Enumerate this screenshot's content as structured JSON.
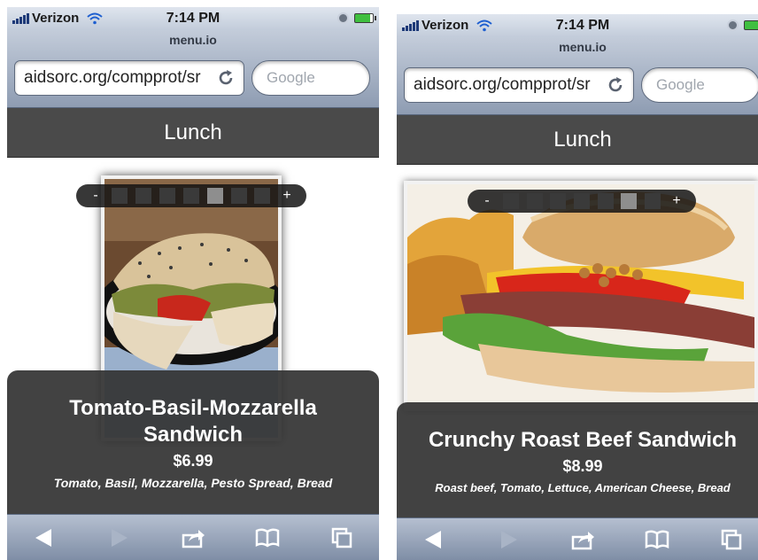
{
  "status": {
    "carrier": "Verizon",
    "time": "7:14 PM",
    "icons": [
      "signal-icon",
      "wifi-icon",
      "lock-icon",
      "battery-icon"
    ]
  },
  "browser": {
    "host": "menu.io",
    "url": "aidsorc.org/compprot/sr",
    "search_placeholder": "Google"
  },
  "header": {
    "title": "Lunch"
  },
  "screens": [
    {
      "item": {
        "name": "Tomato-Basil-Mozzarella Sandwich",
        "price": "$6.99",
        "description": "Tomato, Basil, Mozzarella, Pesto Spread, Bread"
      },
      "pager": {
        "prev": "-",
        "next": "+",
        "count": 6,
        "active_index": 4
      }
    },
    {
      "item": {
        "name": "Crunchy Roast Beef Sandwich",
        "price": "$8.99",
        "description": "Roast beef, Tomato, Lettuce, American Cheese, Bread"
      },
      "pager": {
        "prev": "-",
        "next": "+",
        "count": 7,
        "active_index": 5
      }
    }
  ],
  "toolbar": {
    "icons": [
      "back-arrow-icon",
      "forward-arrow-icon",
      "share-icon",
      "bookmarks-icon",
      "tabs-icon"
    ]
  },
  "colors": {
    "header_bg": "#4a4a4a",
    "card_bg": "#343434",
    "toolbar_blue": "#8e9cb2"
  }
}
